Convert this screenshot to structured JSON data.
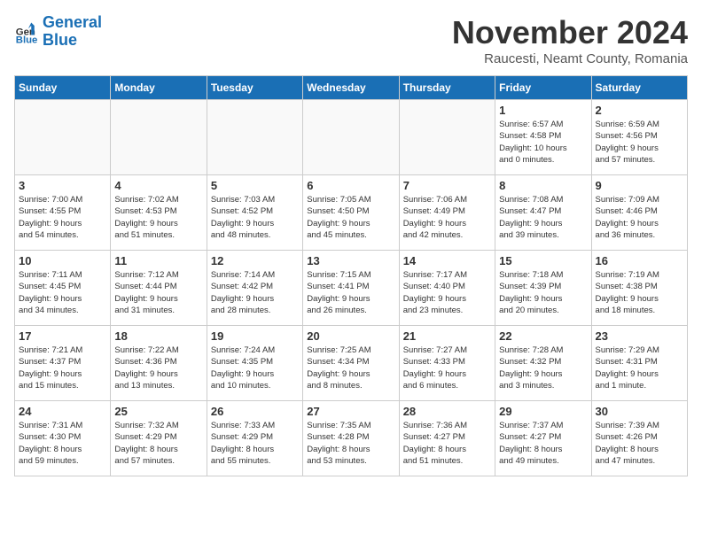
{
  "logo": {
    "line1": "General",
    "line2": "Blue"
  },
  "title": "November 2024",
  "location": "Raucesti, Neamt County, Romania",
  "weekdays": [
    "Sunday",
    "Monday",
    "Tuesday",
    "Wednesday",
    "Thursday",
    "Friday",
    "Saturday"
  ],
  "days": [
    {
      "num": "",
      "info": ""
    },
    {
      "num": "",
      "info": ""
    },
    {
      "num": "",
      "info": ""
    },
    {
      "num": "",
      "info": ""
    },
    {
      "num": "",
      "info": ""
    },
    {
      "num": "1",
      "info": "Sunrise: 6:57 AM\nSunset: 4:58 PM\nDaylight: 10 hours\nand 0 minutes."
    },
    {
      "num": "2",
      "info": "Sunrise: 6:59 AM\nSunset: 4:56 PM\nDaylight: 9 hours\nand 57 minutes."
    },
    {
      "num": "3",
      "info": "Sunrise: 7:00 AM\nSunset: 4:55 PM\nDaylight: 9 hours\nand 54 minutes."
    },
    {
      "num": "4",
      "info": "Sunrise: 7:02 AM\nSunset: 4:53 PM\nDaylight: 9 hours\nand 51 minutes."
    },
    {
      "num": "5",
      "info": "Sunrise: 7:03 AM\nSunset: 4:52 PM\nDaylight: 9 hours\nand 48 minutes."
    },
    {
      "num": "6",
      "info": "Sunrise: 7:05 AM\nSunset: 4:50 PM\nDaylight: 9 hours\nand 45 minutes."
    },
    {
      "num": "7",
      "info": "Sunrise: 7:06 AM\nSunset: 4:49 PM\nDaylight: 9 hours\nand 42 minutes."
    },
    {
      "num": "8",
      "info": "Sunrise: 7:08 AM\nSunset: 4:47 PM\nDaylight: 9 hours\nand 39 minutes."
    },
    {
      "num": "9",
      "info": "Sunrise: 7:09 AM\nSunset: 4:46 PM\nDaylight: 9 hours\nand 36 minutes."
    },
    {
      "num": "10",
      "info": "Sunrise: 7:11 AM\nSunset: 4:45 PM\nDaylight: 9 hours\nand 34 minutes."
    },
    {
      "num": "11",
      "info": "Sunrise: 7:12 AM\nSunset: 4:44 PM\nDaylight: 9 hours\nand 31 minutes."
    },
    {
      "num": "12",
      "info": "Sunrise: 7:14 AM\nSunset: 4:42 PM\nDaylight: 9 hours\nand 28 minutes."
    },
    {
      "num": "13",
      "info": "Sunrise: 7:15 AM\nSunset: 4:41 PM\nDaylight: 9 hours\nand 26 minutes."
    },
    {
      "num": "14",
      "info": "Sunrise: 7:17 AM\nSunset: 4:40 PM\nDaylight: 9 hours\nand 23 minutes."
    },
    {
      "num": "15",
      "info": "Sunrise: 7:18 AM\nSunset: 4:39 PM\nDaylight: 9 hours\nand 20 minutes."
    },
    {
      "num": "16",
      "info": "Sunrise: 7:19 AM\nSunset: 4:38 PM\nDaylight: 9 hours\nand 18 minutes."
    },
    {
      "num": "17",
      "info": "Sunrise: 7:21 AM\nSunset: 4:37 PM\nDaylight: 9 hours\nand 15 minutes."
    },
    {
      "num": "18",
      "info": "Sunrise: 7:22 AM\nSunset: 4:36 PM\nDaylight: 9 hours\nand 13 minutes."
    },
    {
      "num": "19",
      "info": "Sunrise: 7:24 AM\nSunset: 4:35 PM\nDaylight: 9 hours\nand 10 minutes."
    },
    {
      "num": "20",
      "info": "Sunrise: 7:25 AM\nSunset: 4:34 PM\nDaylight: 9 hours\nand 8 minutes."
    },
    {
      "num": "21",
      "info": "Sunrise: 7:27 AM\nSunset: 4:33 PM\nDaylight: 9 hours\nand 6 minutes."
    },
    {
      "num": "22",
      "info": "Sunrise: 7:28 AM\nSunset: 4:32 PM\nDaylight: 9 hours\nand 3 minutes."
    },
    {
      "num": "23",
      "info": "Sunrise: 7:29 AM\nSunset: 4:31 PM\nDaylight: 9 hours\nand 1 minute."
    },
    {
      "num": "24",
      "info": "Sunrise: 7:31 AM\nSunset: 4:30 PM\nDaylight: 8 hours\nand 59 minutes."
    },
    {
      "num": "25",
      "info": "Sunrise: 7:32 AM\nSunset: 4:29 PM\nDaylight: 8 hours\nand 57 minutes."
    },
    {
      "num": "26",
      "info": "Sunrise: 7:33 AM\nSunset: 4:29 PM\nDaylight: 8 hours\nand 55 minutes."
    },
    {
      "num": "27",
      "info": "Sunrise: 7:35 AM\nSunset: 4:28 PM\nDaylight: 8 hours\nand 53 minutes."
    },
    {
      "num": "28",
      "info": "Sunrise: 7:36 AM\nSunset: 4:27 PM\nDaylight: 8 hours\nand 51 minutes."
    },
    {
      "num": "29",
      "info": "Sunrise: 7:37 AM\nSunset: 4:27 PM\nDaylight: 8 hours\nand 49 minutes."
    },
    {
      "num": "30",
      "info": "Sunrise: 7:39 AM\nSunset: 4:26 PM\nDaylight: 8 hours\nand 47 minutes."
    }
  ]
}
